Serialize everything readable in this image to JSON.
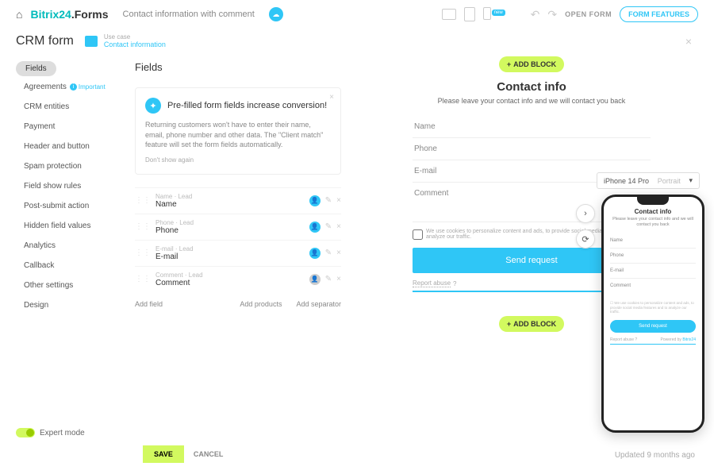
{
  "brand": {
    "part1": "Bitrix",
    "part2": "24",
    "suffix": ".Forms"
  },
  "form_name": "Contact information with comment",
  "badge_new": "new",
  "top": {
    "open_form": "OPEN FORM",
    "features": "FORM FEATURES"
  },
  "header": {
    "title": "CRM form",
    "use_case": "Use case",
    "contact": "Contact information"
  },
  "sidebar": {
    "items": [
      "Fields",
      "Agreements",
      "CRM entities",
      "Payment",
      "Header and button",
      "Spam protection",
      "Field show rules",
      "Post-submit action",
      "Hidden field values",
      "Analytics",
      "Callback",
      "Other settings",
      "Design"
    ],
    "important": "Important"
  },
  "center": {
    "heading": "Fields",
    "tip_title": "Pre-filled form fields increase conversion!",
    "tip_body": "Returning customers won't have to enter their name, email, phone number and other data. The \"Client match\" feature will set the form fields automatically.",
    "tip_dismiss": "Don't show again",
    "fields": [
      {
        "meta": "Name · Lead",
        "name": "Name",
        "color": "blue"
      },
      {
        "meta": "Phone · Lead",
        "name": "Phone",
        "color": "blue"
      },
      {
        "meta": "E-mail · Lead",
        "name": "E-mail",
        "color": "blue"
      },
      {
        "meta": "Comment · Lead",
        "name": "Comment",
        "color": "grey"
      }
    ],
    "add_field": "Add field",
    "add_products": "Add products",
    "add_separator": "Add separator"
  },
  "add_block": "ADD BLOCK",
  "preview": {
    "title": "Contact info",
    "subtitle": "Please leave your contact info and we will contact you back",
    "name": "Name",
    "phone": "Phone",
    "email": "E-mail",
    "comment": "Comment",
    "cookie": "We use cookies to personalize content and ads, to provide social media features and to analyze our traffic.",
    "send": "Send request",
    "report": "Report abuse",
    "powered": "Powered by"
  },
  "phone": {
    "device": "iPhone 14 Pro",
    "orientation": "Portrait",
    "title": "Contact info",
    "subtitle": "Please leave your contact info and we will contact you back",
    "name": "Name",
    "phone": "Phone",
    "email": "E-mail",
    "comment": "Comment",
    "cookie": "We use cookies to personalize content and ads, to provide social media features and to analyze our traffic.",
    "send": "Send request",
    "report": "Report abuse",
    "powered": "Powered by",
    "brand": "Bitrix24"
  },
  "footer": {
    "expert": "Expert mode",
    "save": "SAVE",
    "cancel": "CANCEL",
    "updated": "Updated 9 months ago"
  }
}
